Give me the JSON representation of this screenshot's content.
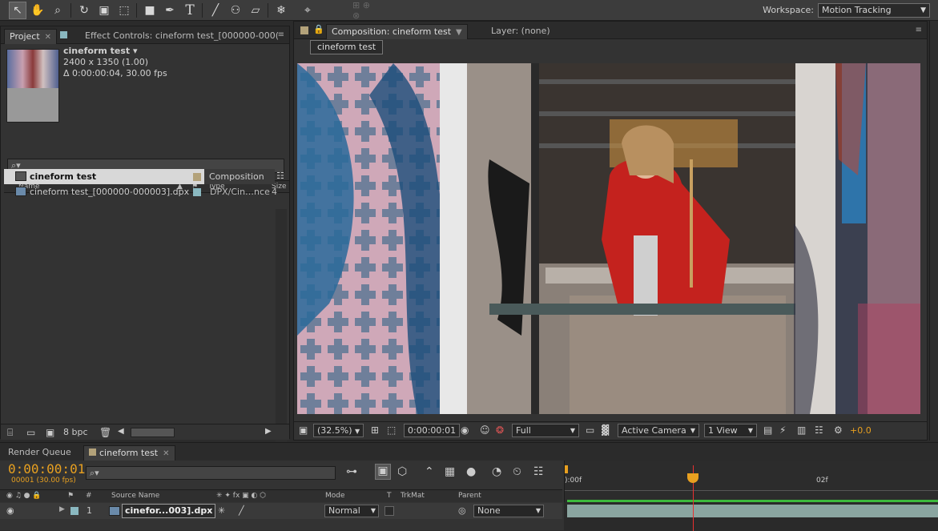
{
  "toolbar": {
    "workspace_label": "Workspace:",
    "workspace_value": "Motion Tracking",
    "tools": [
      "selection-tool",
      "hand-tool",
      "zoom-tool",
      "rotation-tool",
      "camera-tool",
      "pan-behind-tool",
      "rectangle-tool",
      "pen-tool",
      "type-tool",
      "brush-tool",
      "clone-stamp-tool",
      "eraser-tool",
      "roto-brush-tool",
      "puppet-pin-tool"
    ]
  },
  "project_panel": {
    "tab_project": "Project",
    "tab_effect_controls": "Effect Controls: cineform test_[000000-000(",
    "comp_name": "cineform test ▾",
    "comp_size": "2400 x 1350 (1.00)",
    "comp_duration": "Δ 0:00:00:04, 30.00 fps",
    "search_placeholder": "⌕▾",
    "columns": {
      "name": "Name",
      "type": "Type",
      "size": "Size"
    },
    "items": [
      {
        "name": "cineform test",
        "type": "Composition",
        "swatch": "#b3a27a",
        "selected": true
      },
      {
        "name": "cineform test_[000000-000003].dpx",
        "type": "DPX/Cin…nce",
        "swatch": "#8ab8c0",
        "selected": false,
        "size": "4"
      }
    ],
    "bpc": "8 bpc"
  },
  "composition_panel": {
    "tab_label": "Composition: cineform test",
    "layer_tab": "Layer: (none)",
    "comp_label": "cineform test",
    "zoom": "(32.5%)",
    "timecode": "0:00:00:01",
    "resolution": "Full",
    "camera": "Active Camera",
    "views": "1 View",
    "exposure": "+0.0"
  },
  "timeline": {
    "tab_render_queue": "Render Queue",
    "tab_comp": "cineform test",
    "current_time": "0:00:00:01",
    "fps": "00001 (30.00 fps)",
    "search_placeholder": "⌕▾",
    "columns": {
      "num": "#",
      "source_name": "Source Name",
      "mode": "Mode",
      "t": "T",
      "trkmat": "TrkMat",
      "parent": "Parent"
    },
    "layer": {
      "index": "1",
      "name": "cinefor...003].dpx",
      "mode": "Normal",
      "parent": "None"
    },
    "ruler": {
      "start": "):00f",
      "mark": "02f"
    }
  }
}
